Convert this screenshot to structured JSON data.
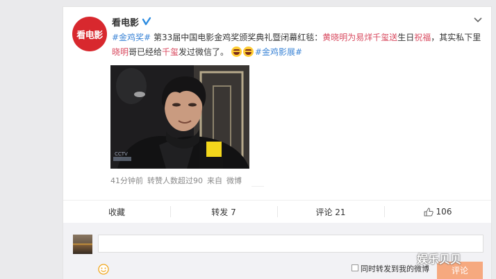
{
  "post": {
    "avatar_text": "看电影",
    "username": "看电影",
    "text": {
      "tag1": "#金鸡奖#",
      "part1": " 第33届中国电影金鸡奖颁奖典礼暨闭幕红毯：",
      "hl1": "黄晓明为易烊千玺送",
      "part2": "生日",
      "hl2": "祝福",
      "part3": "，其实私下里",
      "hl3": "晓明",
      "part4": "哥已经给",
      "hl4": "千玺",
      "part5": "发过微信了。",
      "tag2": "#金鸡影展#"
    },
    "media_caption_tag": "▲",
    "meta": {
      "time": "41分钟前",
      "likes_note": "转赞人数超过90",
      "source_prefix": "来自",
      "source": "微博"
    }
  },
  "actions": {
    "favorite": "收藏",
    "repost": "转发 7",
    "comment": "评论 21",
    "like": "106"
  },
  "comment_box": {
    "repost_label": "同时转发到我的微博",
    "submit": "评论"
  },
  "watermark": "娱乐贝贝",
  "colors": {
    "tag": "#3b84d6",
    "highlight": "#d84a5f",
    "submit_bg": "#f6a97f"
  },
  "icons": [
    "verified-icon",
    "chevron-down-icon",
    "laugh-emoji-icon",
    "thumbs-up-icon",
    "smile-icon"
  ]
}
